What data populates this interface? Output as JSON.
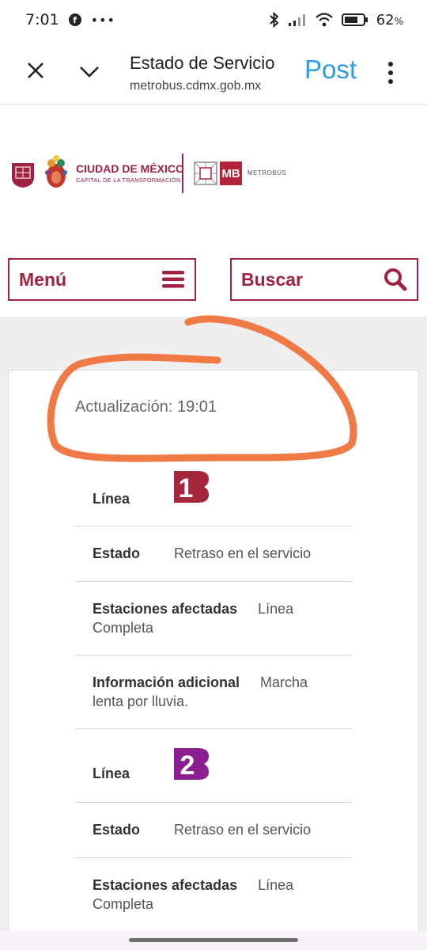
{
  "status_bar": {
    "time": "7:01",
    "battery": "62",
    "battery_unit": "%"
  },
  "toolbar": {
    "title": "Estado de Servicio",
    "url": "metrobus.cdmx.gob.mx",
    "post_label": "Post"
  },
  "header": {
    "cdmx_name": "CIUDAD DE MÉXICO",
    "cdmx_tagline": "CAPITAL DE LA TRANSFORMACIÓN",
    "metrobus_mark": "MB",
    "metrobus_name": "METROBÚS"
  },
  "nav": {
    "menu_label": "Menú",
    "search_label": "Buscar"
  },
  "service": {
    "updated": "Actualización: 19:01",
    "lines": [
      {
        "number": "1",
        "color": "#a3263a",
        "line_label": "Línea",
        "status_label": "Estado",
        "status_value": "Retraso en el servicio",
        "stations_label": "Estaciones afectadas",
        "stations_value": "Línea Completa",
        "info_label": "Información adicional",
        "info_value": "Marcha lenta por lluvia."
      },
      {
        "number": "2",
        "color": "#8b1f8f",
        "line_label": "Línea",
        "status_label": "Estado",
        "status_value": "Retraso en el servicio",
        "stations_label": "Estaciones afectadas",
        "stations_value": "Línea Completa"
      }
    ]
  },
  "colors": {
    "brand": "#9f2241",
    "post": "#2d9ce3",
    "annotation": "#f07a45"
  }
}
